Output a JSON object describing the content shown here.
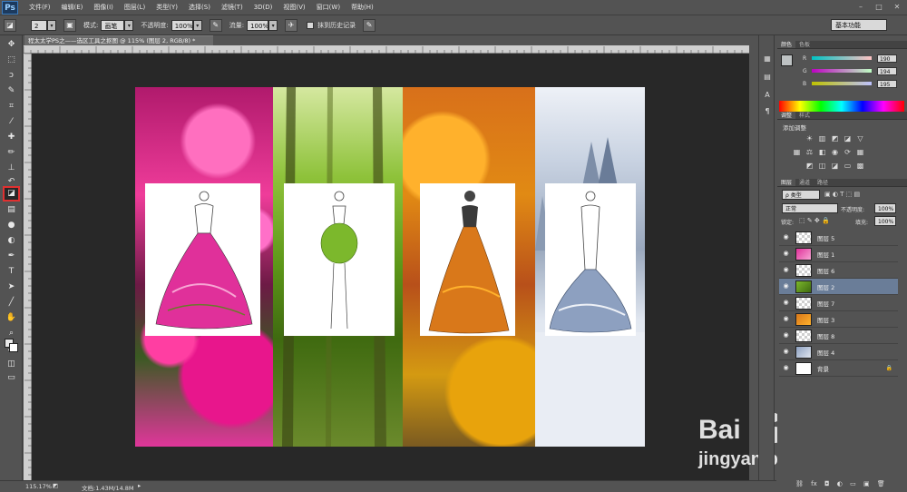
{
  "app": {
    "logo": "Ps"
  },
  "menu": [
    "文件(F)",
    "编辑(E)",
    "图像(I)",
    "图层(L)",
    "类型(Y)",
    "选择(S)",
    "滤镜(T)",
    "3D(D)",
    "视图(V)",
    "窗口(W)",
    "帮助(H)"
  ],
  "options": {
    "brush_size": "2",
    "mode_label": "模式:",
    "mode_value": "画笔",
    "opacity_label": "不透明度:",
    "opacity_value": "100%",
    "flow_label": "流量:",
    "flow_value": "100%",
    "history_label": "抹到历史记录",
    "workspace": "基本功能"
  },
  "document": {
    "tab_title": "程太太学PS之——选区工具之抠图 @ 115% (图层 2, RGB/8) *"
  },
  "tools": [
    {
      "name": "move-tool",
      "glyph": "✥"
    },
    {
      "name": "marquee-tool",
      "glyph": "⬚"
    },
    {
      "name": "lasso-tool",
      "glyph": "ↄ"
    },
    {
      "name": "quick-select-tool",
      "glyph": "✎"
    },
    {
      "name": "crop-tool",
      "glyph": "⌗"
    },
    {
      "name": "eyedropper-tool",
      "glyph": "⁄"
    },
    {
      "name": "healing-tool",
      "glyph": "✚"
    },
    {
      "name": "brush-tool",
      "glyph": "✏"
    },
    {
      "name": "stamp-tool",
      "glyph": "⊥"
    },
    {
      "name": "history-brush-tool",
      "glyph": "↶"
    },
    {
      "name": "eraser-tool",
      "glyph": "◪"
    },
    {
      "name": "gradient-tool",
      "glyph": "▤"
    },
    {
      "name": "blur-tool",
      "glyph": "●"
    },
    {
      "name": "dodge-tool",
      "glyph": "◐"
    },
    {
      "name": "pen-tool",
      "glyph": "✒"
    },
    {
      "name": "type-tool",
      "glyph": "T"
    },
    {
      "name": "path-select-tool",
      "glyph": "➤"
    },
    {
      "name": "shape-tool",
      "glyph": "╱"
    },
    {
      "name": "hand-tool",
      "glyph": "✋"
    },
    {
      "name": "zoom-tool",
      "glyph": "⌕"
    },
    {
      "name": "more-tools",
      "glyph": "…"
    }
  ],
  "color_panel": {
    "tabs": [
      "颜色",
      "色板"
    ],
    "r": "190",
    "g": "194",
    "b": "195"
  },
  "adjust_panel": {
    "tabs": [
      "调整",
      "样式"
    ],
    "add_label": "添加调整"
  },
  "layers_panel": {
    "tabs": [
      "图层",
      "通道",
      "路径"
    ],
    "filter_label": "ρ 类型",
    "blend_mode": "正常",
    "opacity_label": "不透明度:",
    "opacity_value": "100%",
    "lock_label": "锁定:",
    "fill_label": "填充:",
    "fill_value": "100%",
    "layers": [
      {
        "name": "图层 5",
        "thumb": "checker",
        "selected": false
      },
      {
        "name": "图层 1",
        "thumb": "pink",
        "selected": false
      },
      {
        "name": "图层 6",
        "thumb": "checker",
        "selected": false
      },
      {
        "name": "图层 2",
        "thumb": "green",
        "selected": true
      },
      {
        "name": "图层 7",
        "thumb": "checker",
        "selected": false
      },
      {
        "name": "图层 3",
        "thumb": "orange",
        "selected": false
      },
      {
        "name": "图层 8",
        "thumb": "checker",
        "selected": false
      },
      {
        "name": "图层 4",
        "thumb": "blue",
        "selected": false
      },
      {
        "name": "背景",
        "thumb": "white",
        "selected": false
      }
    ]
  },
  "status": {
    "zoom": "115.17%",
    "doc_size": "文档:1.43M/14.8M"
  },
  "watermark": {
    "brand": "Bai",
    "brand_tail": "经验",
    "url": "jingyan.baidu.com"
  }
}
